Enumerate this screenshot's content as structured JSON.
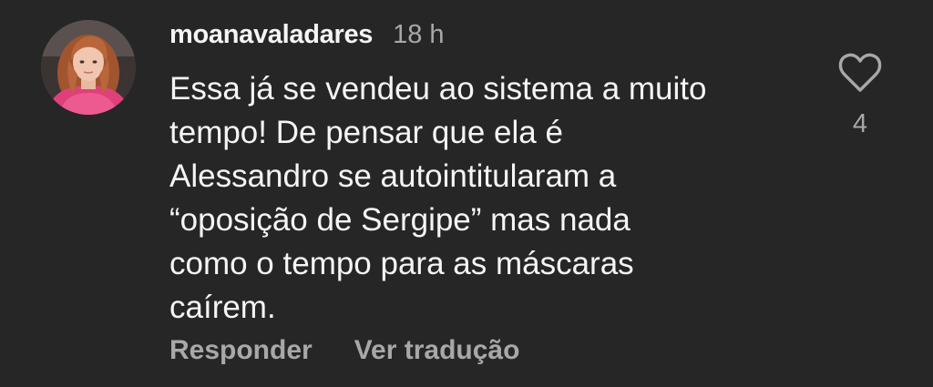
{
  "comment": {
    "username": "moanavaladares",
    "time_ago": "18 h",
    "text_lines": [
      "Essa já se vendeu ao sistema a muito",
      "tempo! De pensar que ela é",
      "Alessandro se autointitularam a",
      "“oposição de Sergipe” mas nada",
      "como o tempo para as máscaras",
      "caírem."
    ],
    "like_count": "4",
    "actions": {
      "reply_label": "Responder",
      "translate_label": "Ver tradução"
    },
    "icons": {
      "like": "heart-outline-icon",
      "avatar": "profile-photo"
    },
    "colors": {
      "background": "#262626",
      "primary_text": "#f5f5f5",
      "secondary_text": "#a8a8a8"
    }
  }
}
